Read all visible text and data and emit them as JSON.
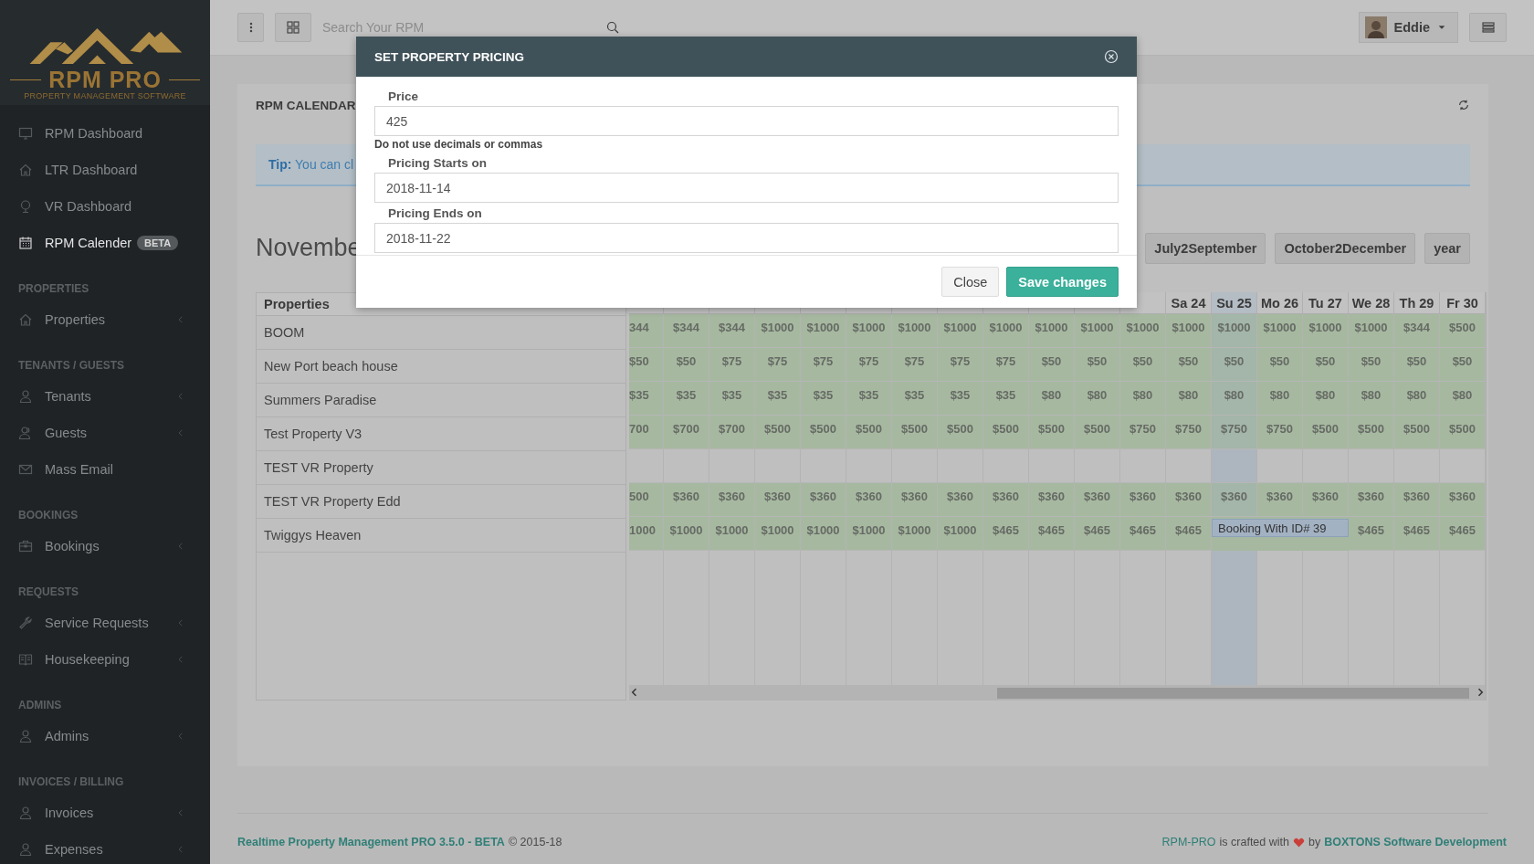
{
  "sidebar": {
    "logo": {
      "title": "RPM PRO",
      "subtitle": "PROPERTY MANAGEMENT SOFTWARE"
    },
    "sections": [
      {
        "items": [
          {
            "label": "RPM Dashboard",
            "selected": false,
            "submenu": false
          },
          {
            "label": "LTR Dashboard",
            "selected": false,
            "submenu": false
          },
          {
            "label": "VR Dashboard",
            "selected": false,
            "submenu": false
          },
          {
            "label": "RPM Calender",
            "selected": true,
            "submenu": false,
            "badge": "BETA"
          }
        ]
      },
      {
        "title": "PROPERTIES",
        "items": [
          {
            "label": "Properties",
            "selected": false,
            "submenu": true
          }
        ]
      },
      {
        "title": "TENANTS / GUESTS",
        "items": [
          {
            "label": "Tenants",
            "selected": false,
            "submenu": true
          },
          {
            "label": "Guests",
            "selected": false,
            "submenu": true
          },
          {
            "label": "Mass Email",
            "selected": false,
            "submenu": false
          }
        ]
      },
      {
        "title": "BOOKINGS",
        "items": [
          {
            "label": "Bookings",
            "selected": false,
            "submenu": true
          }
        ]
      },
      {
        "title": "REQUESTS",
        "items": [
          {
            "label": "Service Requests",
            "selected": false,
            "submenu": true
          },
          {
            "label": "Housekeeping",
            "selected": false,
            "submenu": true
          }
        ]
      },
      {
        "title": "ADMINS",
        "items": [
          {
            "label": "Admins",
            "selected": false,
            "submenu": true
          }
        ]
      },
      {
        "title": "INVOICES / BILLING",
        "items": [
          {
            "label": "Invoices",
            "selected": false,
            "submenu": true
          },
          {
            "label": "Expenses",
            "selected": false,
            "submenu": true
          }
        ]
      }
    ]
  },
  "topbar": {
    "search": {
      "placeholder": "Search Your RPM"
    },
    "user": {
      "name": "Eddie"
    }
  },
  "panel": {
    "title": "RPM CALENDAR",
    "tip": "**Tip:** You can cl"
  },
  "calendar": {
    "month": "Novembe",
    "views": [
      "July2September",
      "October2December",
      "year"
    ],
    "properties_heading": "Properties",
    "days": [
      {
        "label": "Sa 24",
        "today": false
      },
      {
        "label": "Su 25",
        "today": true
      },
      {
        "label": "Mo 26",
        "today": false
      },
      {
        "label": "Tu 27",
        "today": false
      },
      {
        "label": "We 28",
        "today": false
      },
      {
        "label": "Th 29",
        "today": false
      },
      {
        "label": "Fr 30",
        "today": false
      }
    ],
    "rows": [
      {
        "name": "BOOM",
        "cells": [
          "344",
          "$344",
          "$344",
          "$1000",
          "$1000",
          "$1000",
          "$1000",
          "$1000",
          "$1000",
          "$1000",
          "$1000",
          "$1000",
          "$1000",
          "$1000",
          "$1000",
          "$1000",
          "$1000",
          "$344",
          "$500"
        ]
      },
      {
        "name": "New Port beach house",
        "cells": [
          "$50",
          "$50",
          "$75",
          "$75",
          "$75",
          "$75",
          "$75",
          "$75",
          "$75",
          "$50",
          "$50",
          "$50",
          "$50",
          "$50",
          "$50",
          "$50",
          "$50",
          "$50",
          "$50"
        ]
      },
      {
        "name": "Summers Paradise",
        "cells": [
          "$35",
          "$35",
          "$35",
          "$35",
          "$35",
          "$35",
          "$35",
          "$35",
          "$35",
          "$80",
          "$80",
          "$80",
          "$80",
          "$80",
          "$80",
          "$80",
          "$80",
          "$80",
          "$80"
        ]
      },
      {
        "name": "Test Property V3",
        "cells": [
          "700",
          "$700",
          "$700",
          "$500",
          "$500",
          "$500",
          "$500",
          "$500",
          "$500",
          "$500",
          "$500",
          "$750",
          "$750",
          "$750",
          "$750",
          "$500",
          "$500",
          "$500",
          "$500"
        ]
      },
      {
        "name": "TEST VR Property",
        "cells": []
      },
      {
        "name": "TEST VR Property Edd",
        "cells": [
          "500",
          "$360",
          "$360",
          "$360",
          "$360",
          "$360",
          "$360",
          "$360",
          "$360",
          "$360",
          "$360",
          "$360",
          "$360",
          "$360",
          "$360",
          "$360",
          "$360",
          "$360",
          "$360"
        ]
      },
      {
        "name": "Twiggys Heaven",
        "cells": [
          "1000",
          "$1000",
          "$1000",
          "$1000",
          "$1000",
          "$1000",
          "$1000",
          "$1000",
          "$465",
          "$465",
          "$465",
          "$465",
          "$465",
          {
            "kind": "booking",
            "text": "Booking With ID# 39"
          },
          "",
          "",
          "$465",
          "$465",
          "$465"
        ]
      }
    ]
  },
  "modal": {
    "title": "SET PROPERTY PRICING",
    "fields": [
      {
        "label": "Price",
        "value": "425",
        "help": "Do not use decimals or commas"
      },
      {
        "label": "Pricing Starts on",
        "value": "2018-11-14"
      },
      {
        "label": "Pricing Ends on",
        "value": "2018-11-22"
      }
    ],
    "buttons": [
      {
        "label": "Close",
        "kind": "default"
      },
      {
        "label": "Save changes",
        "kind": "primary"
      }
    ]
  },
  "footer": {
    "left": {
      "link": "Realtime Property Management PRO 3.5.0 - BETA",
      "text": "© 2015-18"
    },
    "right": {
      "link": "RPM-PRO",
      "text": "is crafted with",
      "text_2": "by",
      "link_2": "BOXTONS Software Development"
    }
  }
}
